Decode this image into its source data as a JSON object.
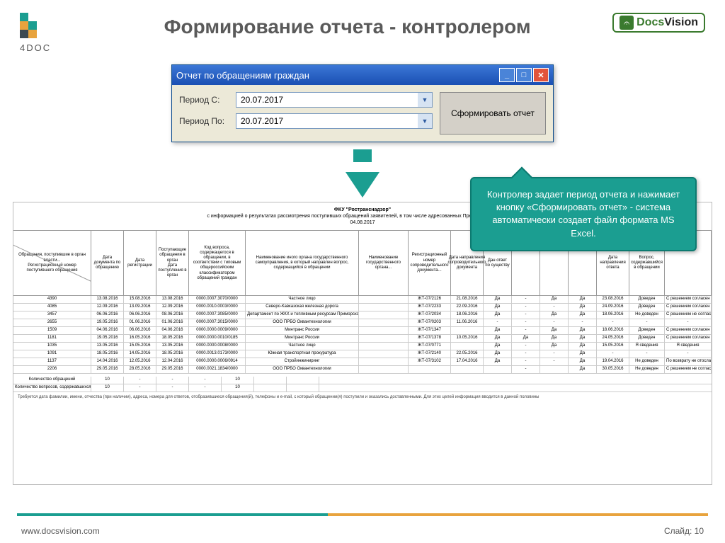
{
  "header": {
    "logo_text": "4DOC",
    "title": "Формирование отчета - контролером",
    "dv_docs": "Docs",
    "dv_vision": "Vision"
  },
  "dialog": {
    "title": "Отчет по обращениям граждан",
    "from_label": "Период С:",
    "to_label": "Период По:",
    "from_value": "20.07.2017",
    "to_value": "20.07.2017",
    "generate": "Сформировать отчет"
  },
  "callout": {
    "text": "Контролер задает период отчета и нажимает кнопку «Сформировать отчет» - система автоматически создает файл формата MS Excel."
  },
  "excel": {
    "org": "ФКУ \"Ространснадзор\"",
    "subtitle": "с информацией о результатах рассмотрения поступивших обращений заявителей, в том числе адресованных Президенту Российской",
    "date": "04.08.2017",
    "rows": [
      {
        "n": "4390",
        "d1": "13.08.2016",
        "d2": "15.08.2016",
        "d3": "13.08.2016",
        "code": "0000.0007.3070/0000",
        "org": "Частное лицо",
        "res": "ЖТ-07/2126",
        "dd": "21.08.2016",
        "a": "Да",
        "b": "-",
        "c": "Да",
        "d": "Да",
        "e": "23.08.2016",
        "f": "Доведен",
        "g": "С решением согласен"
      },
      {
        "n": "4085",
        "d1": "12.09.2016",
        "d2": "13.09.2016",
        "d3": "12.09.2016",
        "code": "0000.0010.0003/0000",
        "org": "Северо-Кавказская железная дорога",
        "res": "ЖТ-07/2233",
        "dd": "22.09.2016",
        "a": "Да",
        "b": "-",
        "c": "-",
        "d": "Да",
        "e": "24.09.2016",
        "f": "Доведен",
        "g": "С решением согласен"
      },
      {
        "n": "3457",
        "d1": "06.06.2016",
        "d2": "06.06.2016",
        "d3": "08.06.2016",
        "code": "0000.0007.3085/0000",
        "org": "Департамент по ЖКХ и топливным ресурсам Приморского края",
        "res": "ЖТ-07/2034",
        "dd": "18.06.2016",
        "a": "Да",
        "b": "-",
        "c": "Да",
        "d": "Да",
        "e": "18.06.2016",
        "f": "Не доведен",
        "g": "С решением не согласен"
      },
      {
        "n": "2655",
        "d1": "19.05.2016",
        "d2": "01.06.2016",
        "d3": "01.06.2016",
        "code": "0000.0007.3015/0000",
        "org": "ООО ПРБО Оквантехнологии",
        "res": "ЖТ-07/0203",
        "dd": "11.06.2016",
        "a": "-",
        "b": "-",
        "c": "-",
        "d": "-",
        "e": "-",
        "f": "-",
        "g": "-"
      },
      {
        "n": "1509",
        "d1": "04.06.2016",
        "d2": "06.06.2016",
        "d3": "04.06.2016",
        "code": "0000.0000.0009/0000",
        "org": "Минтранс России",
        "res": "ЖТ-07/1347",
        "dd": "",
        "a": "Да",
        "b": "-",
        "c": "Да",
        "d": "Да",
        "e": "18.06.2016",
        "f": "Доведен",
        "g": "С решением согласен"
      },
      {
        "n": "1181",
        "d1": "19.05.2016",
        "d2": "16.05.2016",
        "d3": "18.05.2016",
        "code": "0000.0000.0010/0185",
        "org": "Минтранс России",
        "res": "ЖТ-07/1378",
        "dd": "10.05.2016",
        "a": "Да",
        "b": "Да",
        "c": "Да",
        "d": "Да",
        "e": "24.05.2016",
        "f": "Доведен",
        "g": "С решением согласен"
      },
      {
        "n": "1035",
        "d1": "13.05.2016",
        "d2": "15.05.2016",
        "d3": "13.05.2016",
        "code": "0000.0000.0008/0000",
        "org": "Частное лицо",
        "res": "ЖТ-07/0771",
        "dd": "",
        "a": "Да",
        "b": "-",
        "c": "Да",
        "d": "Да",
        "e": "15.05.2016",
        "f": "Я сведения",
        "g": "Я сведения"
      },
      {
        "n": "1091",
        "d1": "18.05.2016",
        "d2": "14.05.2016",
        "d3": "18.05.2016",
        "code": "0000.0013.0173/0000",
        "org": "Южная транспортная прокуратура",
        "res": "ЖТ-07/2140",
        "dd": "22.05.2016",
        "a": "Да",
        "b": "-",
        "c": "-",
        "d": "Да",
        "e": "-",
        "f": "-",
        "g": "-"
      },
      {
        "n": "1137",
        "d1": "14.04.2016",
        "d2": "12.05.2016",
        "d3": "12.04.2016",
        "code": "0000.0000.0006/0914",
        "org": "Стройинжиниринг",
        "res": "ЖТ-07/3102",
        "dd": "17.04.2016",
        "a": "Да",
        "b": "-",
        "c": "-",
        "d": "Да",
        "e": "19.04.2016",
        "f": "Не доведен",
        "g": "По возврату не отосланы"
      },
      {
        "n": "2206",
        "d1": "29.05.2016",
        "d2": "28.05.2016",
        "d3": "29.05.2016",
        "code": "0000.0021.1834/0000",
        "org": "ООО ПРБО Оквантехнологии",
        "res": "",
        "dd": "",
        "a": "",
        "b": "-",
        "c": "",
        "d": "Да",
        "e": "30.05.2016",
        "f": "Не доведен",
        "g": "С решением не согласен"
      }
    ],
    "summary": [
      {
        "label": "Количество обращений",
        "v": "10"
      },
      {
        "label": "Количество вопросов, содержавшихся в обращении, в том числе",
        "v": "10"
      }
    ]
  },
  "footer": {
    "url": "www.docsvision.com",
    "slide": "Слайд: 10"
  }
}
